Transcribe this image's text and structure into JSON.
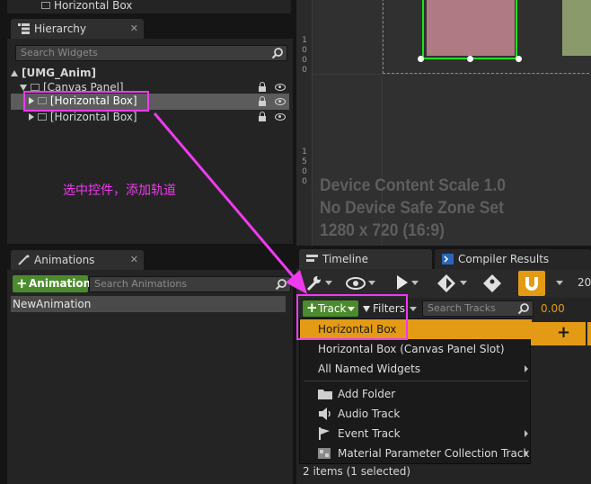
{
  "top": {
    "partial_item": "Horizontal Box"
  },
  "hierarchy": {
    "tab_label": "Hierarchy",
    "search_placeholder": "Search Widgets",
    "tree": [
      {
        "label": "[UMG_Anim]"
      },
      {
        "label": "[Canvas Panel]"
      },
      {
        "label": "[Horizontal Box]",
        "selected": true
      },
      {
        "label": "[Horizontal Box]"
      }
    ]
  },
  "annotation": {
    "text": "选中控件，添加轨道"
  },
  "designer": {
    "ruler_vertical_top": [
      "1",
      "0",
      "0",
      "0"
    ],
    "ruler_vertical_bottom": [
      "1",
      "5",
      "0",
      "0"
    ],
    "overlay_lines": [
      "Device Content Scale 1.0",
      "No Device Safe Zone Set",
      "1280 x 720 (16:9)"
    ]
  },
  "animations": {
    "tab_label": "Animations",
    "add_button_label": "Animation",
    "search_placeholder": "Search Animations",
    "items": [
      "NewAnimation"
    ]
  },
  "timeline": {
    "tabs": [
      "Timeline",
      "Compiler Results"
    ],
    "toolbar_value": "20",
    "track_button_label": "Track",
    "filters_button_label": "Filters",
    "search_placeholder": "Search Tracks",
    "time_value": "0.00",
    "status": "2 items (1 selected)"
  },
  "track_menu": {
    "items": [
      {
        "label": "Horizontal Box",
        "highlighted": true
      },
      {
        "label": "Horizontal Box (Canvas Panel Slot)"
      },
      {
        "label": "All Named Widgets",
        "submenu": true
      }
    ],
    "icon_items": [
      {
        "label": "Add Folder",
        "icon": "folder-icon"
      },
      {
        "label": "Audio Track",
        "icon": "speaker-icon"
      },
      {
        "label": "Event Track",
        "icon": "flag-icon",
        "submenu": true
      },
      {
        "label": "Material Parameter Collection Track",
        "icon": "material-icon",
        "submenu": true
      }
    ]
  },
  "colors": {
    "highlight": "#e39b15",
    "annotation": "#ee3bee",
    "green_button": "#4b8b2d"
  }
}
